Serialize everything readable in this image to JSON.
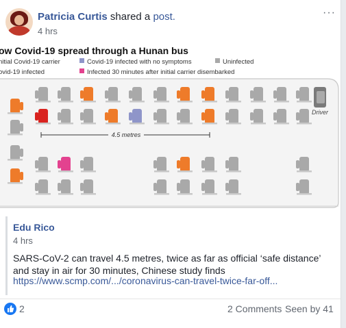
{
  "post": {
    "author": "Patricia Curtis",
    "action": "shared a",
    "object": "post.",
    "time": "4 hrs"
  },
  "infographic": {
    "title": "ow Covid-19 spread through a Hunan bus",
    "legend": {
      "carrier": "nitial Covid-19 carrier",
      "no_symptoms": "Covid-19 infected with no symptoms",
      "uninfected": "Uninfected",
      "infected": "ovid-19 infected",
      "after": "Infected 30 minutes after initial carrier disembarked"
    },
    "colors": {
      "carrier": "#d9231f",
      "infected": "#ee7b2a",
      "no_symptoms": "#8f95c9",
      "uninfected": "#a9a9a9",
      "after": "#e3428f"
    },
    "distance_label": "4.5 metres",
    "driver_label": "Driver"
  },
  "shared": {
    "source": "Edu Rico",
    "time": "4 hrs",
    "text": "SARS-CoV-2 can travel 4.5 metres, twice as far as official ‘safe distance’ and stay in air for 30 minutes, Chinese study finds",
    "url": "https://www.scmp.com/.../coronavirus-can-travel-twice-far-off..."
  },
  "footer": {
    "reactions": "2",
    "comments": "2 Comments",
    "seen": "Seen by 41"
  }
}
